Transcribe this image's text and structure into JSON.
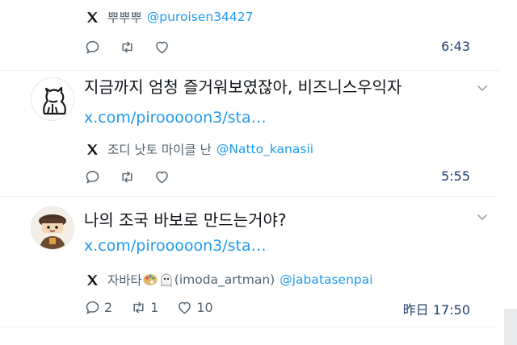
{
  "tweets": [
    {
      "source": {
        "name": "뿌뿌뿌",
        "handle": "@puroisen34427"
      },
      "actions": {
        "reply_count": "",
        "retweet_count": "",
        "like_count": ""
      },
      "time": "6:43"
    },
    {
      "avatar_icon": "cat-silhouette-icon",
      "text": "지금까지 엄청 즐거워보였잖아, 비즈니스우익자",
      "link": "x.com/pirooooon3/sta…",
      "source": {
        "name": "조디 낫토 마이클 난",
        "handle": "@Natto_kanasii"
      },
      "actions": {
        "reply_count": "",
        "retweet_count": "",
        "like_count": ""
      },
      "time": "5:55"
    },
    {
      "avatar_icon": "cartoon-character-icon",
      "text": "나의 조국 바보로 만드는거야?",
      "link": "x.com/pirooooon3/sta…",
      "source": {
        "name_prefix": "자바타",
        "name_suffix": "(imoda_artman)",
        "handle": "@jabatasenpai"
      },
      "actions": {
        "reply_count": "2",
        "retweet_count": "1",
        "like_count": "10"
      },
      "time": "昨日 17:50"
    }
  ],
  "icons": {
    "source": "x-logo-icon",
    "reply": "reply-bubble-icon",
    "retweet": "retweet-icon",
    "like": "heart-icon",
    "more": "chevron-down-icon",
    "emoji": [
      "palette-emoji-icon",
      "ghost-emoji-icon"
    ]
  },
  "colors": {
    "link": "#1d9bf0",
    "secondary_text": "#536471",
    "time_text": "#1d3f6e",
    "divider": "#eff3f4"
  }
}
